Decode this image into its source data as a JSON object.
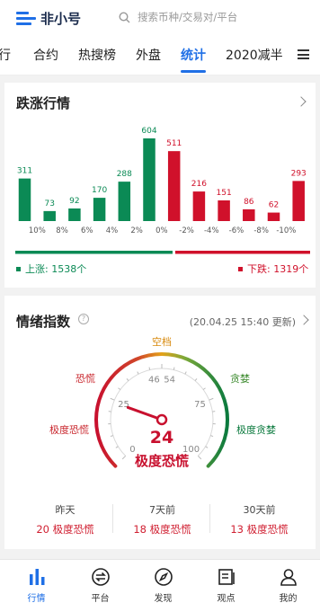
{
  "app": {
    "logo_text": "非小号"
  },
  "search": {
    "placeholder": "搜索币种/交易对/平台"
  },
  "tabs": [
    {
      "label": "行"
    },
    {
      "label": "合约"
    },
    {
      "label": "热搜榜"
    },
    {
      "label": "外盘"
    },
    {
      "label": "统计",
      "active": true
    },
    {
      "label": "2020减半"
    }
  ],
  "rise_fall": {
    "title": "跌涨行情",
    "up_label": "上涨: 1538个",
    "down_label": "下跌: 1319个",
    "up_count": 1538,
    "down_count": 1319,
    "colors": {
      "up": "#0b8a55",
      "down": "#d0112b"
    }
  },
  "chart_data": {
    "type": "bar",
    "categories": [
      "10%",
      "8%",
      "6%",
      "4%",
      "2%",
      "0%",
      "-2%",
      "-4%",
      "-6%",
      "-8%",
      "-10%"
    ],
    "values": [
      311,
      73,
      92,
      170,
      288,
      604,
      511,
      216,
      151,
      86,
      62,
      293
    ],
    "ylim": [
      0,
      604
    ]
  },
  "sentiment": {
    "title": "情绪指数",
    "updated": "(20.04.25 15:40 更新)",
    "value": 24,
    "value_label": "24",
    "state_label": "极度恐慌",
    "scale": {
      "min": 0,
      "max": 100,
      "ticks": [
        "0",
        "25",
        "46",
        "54",
        "75",
        "100"
      ]
    },
    "zones": {
      "extreme_fear_left": "极度恐慌",
      "fear": "恐慌",
      "neutral": "空档",
      "greed": "贪婪",
      "extreme_greed": "极度贪婪"
    },
    "history": [
      {
        "label": "昨天",
        "value": "20 极度恐慌"
      },
      {
        "label": "7天前",
        "value": "18 极度恐慌"
      },
      {
        "label": "30天前",
        "value": "13 极度恐慌"
      }
    ]
  },
  "nav": [
    {
      "label": "行情",
      "icon": "bar-chart-icon",
      "active": true
    },
    {
      "label": "平台",
      "icon": "exchange-icon"
    },
    {
      "label": "发现",
      "icon": "compass-icon"
    },
    {
      "label": "观点",
      "icon": "article-icon"
    },
    {
      "label": "我的",
      "icon": "user-icon"
    }
  ]
}
